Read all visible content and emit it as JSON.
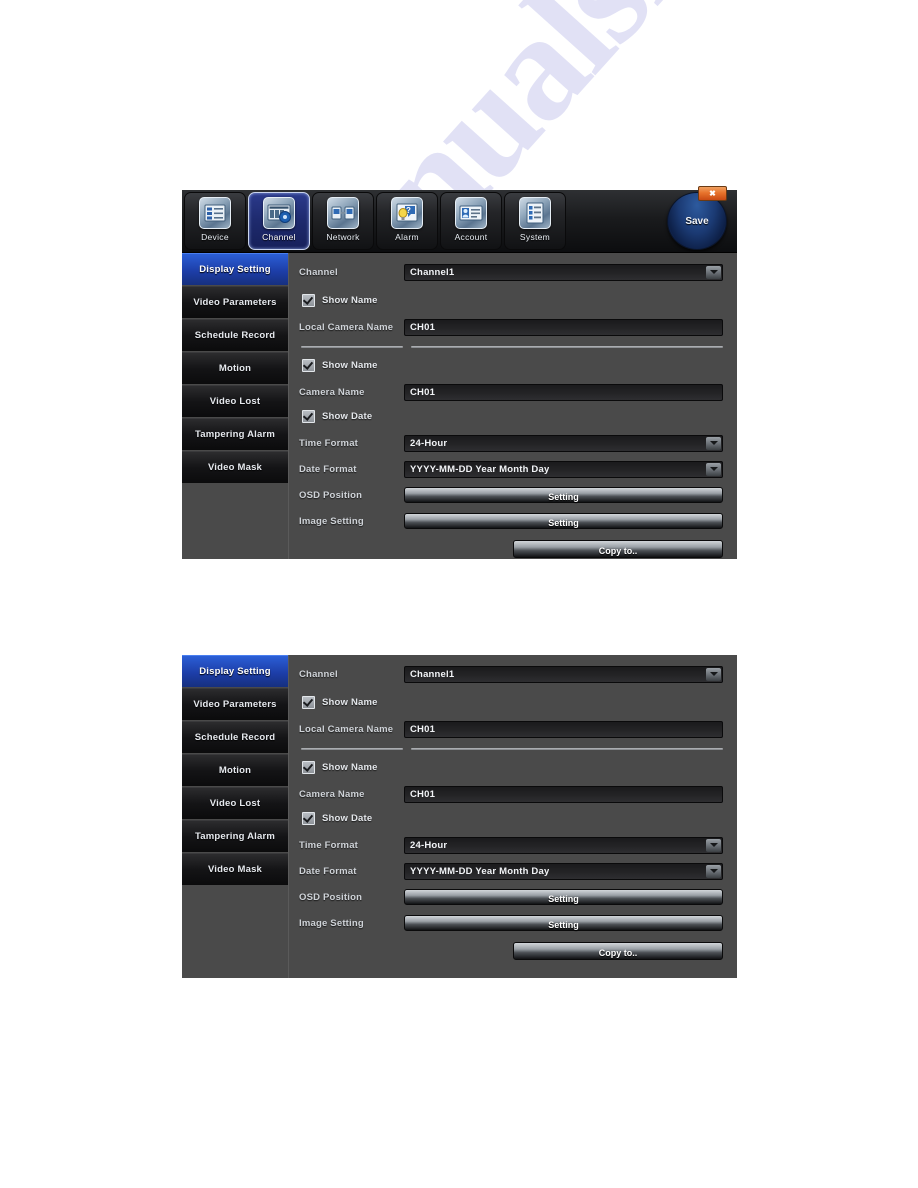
{
  "watermark": {
    "text": "manualshive.com"
  },
  "toolbar": {
    "items": [
      {
        "label": "Device",
        "icon": "device-list-icon",
        "selected": false
      },
      {
        "label": "Channel",
        "icon": "channel-video-icon",
        "selected": true
      },
      {
        "label": "Network",
        "icon": "network-nodes-icon",
        "selected": false
      },
      {
        "label": "Alarm",
        "icon": "alarm-bulb-icon",
        "selected": false
      },
      {
        "label": "Account",
        "icon": "account-card-icon",
        "selected": false
      },
      {
        "label": "System",
        "icon": "system-list-icon",
        "selected": false
      }
    ],
    "save_label": "Save",
    "close_label": "✖"
  },
  "sidebar": {
    "items": [
      {
        "label": "Display Setting",
        "active": true
      },
      {
        "label": "Video Parameters",
        "active": false
      },
      {
        "label": "Schedule Record",
        "active": false
      },
      {
        "label": "Motion",
        "active": false
      },
      {
        "label": "Video Lost",
        "active": false
      },
      {
        "label": "Tampering Alarm",
        "active": false
      },
      {
        "label": "Video Mask",
        "active": false
      }
    ]
  },
  "form": {
    "channel_label": "Channel",
    "channel_value": "Channel1",
    "show_name_1_label": "Show Name",
    "show_name_1_checked": true,
    "local_camera_name_label": "Local Camera Name",
    "local_camera_name_value": "CH01",
    "show_name_2_label": "Show Name",
    "show_name_2_checked": true,
    "camera_name_label": "Camera Name",
    "camera_name_value": "CH01",
    "show_date_label": "Show Date",
    "show_date_checked": true,
    "time_format_label": "Time Format",
    "time_format_value": "24-Hour",
    "date_format_label": "Date Format",
    "date_format_value": "YYYY-MM-DD Year Month Day",
    "osd_position_label": "OSD Position",
    "osd_position_button": "Setting",
    "image_setting_label": "Image Setting",
    "image_setting_button": "Setting",
    "copy_to_button": "Copy to.."
  },
  "colors": {
    "accent_blue": "#1d3ea8",
    "panel_gray": "#4a4a4a",
    "field_dark": "#1a1a1c",
    "close_orange": "#e8732c"
  }
}
